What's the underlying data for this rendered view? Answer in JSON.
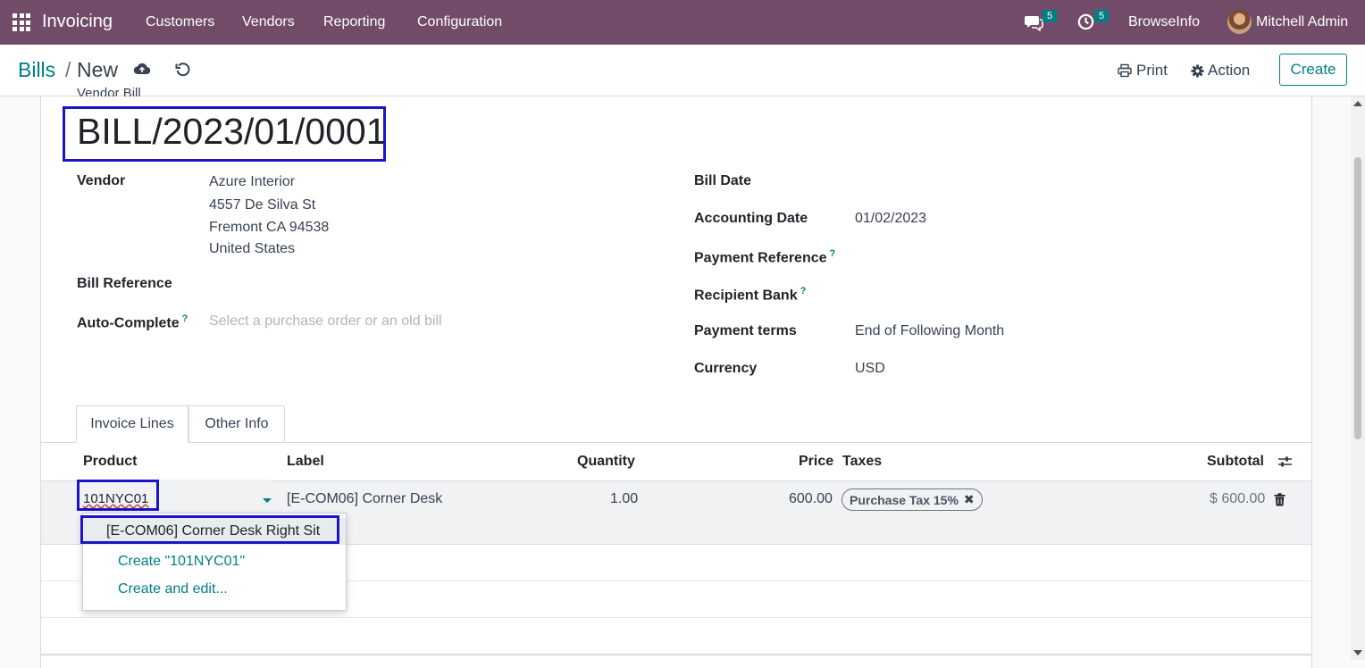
{
  "navbar": {
    "app_name": "Invoicing",
    "menu": [
      "Customers",
      "Vendors",
      "Reporting",
      "Configuration"
    ],
    "messages_count": "5",
    "activities_count": "5",
    "company": "BrowseInfo",
    "user": "Mitchell Admin"
  },
  "breadcrumb": {
    "parent": "Bills",
    "separator": "/",
    "current": "New"
  },
  "control_panel": {
    "print_label": "Print",
    "action_label": "Action",
    "create_label": "Create"
  },
  "form": {
    "doc_type_label": "Vendor Bill",
    "bill_number": "BILL/2023/01/0001",
    "vendor": {
      "label": "Vendor",
      "name": "Azure Interior",
      "street": "4557 De Silva St",
      "city": "Fremont CA 94538",
      "country": "United States"
    },
    "bill_reference_label": "Bill Reference",
    "auto_complete": {
      "label": "Auto-Complete",
      "help": "?",
      "placeholder": "Select a purchase order or an old bill"
    },
    "bill_date_label": "Bill Date",
    "accounting_date": {
      "label": "Accounting Date",
      "value": "01/02/2023"
    },
    "payment_reference": {
      "label": "Payment Reference",
      "help": "?"
    },
    "recipient_bank": {
      "label": "Recipient Bank",
      "help": "?"
    },
    "payment_terms": {
      "label": "Payment terms",
      "value": "End of Following Month"
    },
    "currency": {
      "label": "Currency",
      "value": "USD"
    }
  },
  "tabs": [
    "Invoice Lines",
    "Other Info"
  ],
  "lines_table": {
    "headers": {
      "product": "Product",
      "label": "Label",
      "quantity": "Quantity",
      "price": "Price",
      "taxes": "Taxes",
      "subtotal": "Subtotal"
    },
    "row": {
      "product_input": "101NYC01",
      "label": "[E-COM06] Corner Desk",
      "quantity": "1.00",
      "price": "600.00",
      "tax": "Purchase Tax 15%",
      "subtotal": "$ 600.00"
    }
  },
  "autocomplete_dropdown": {
    "suggestion": "[E-COM06] Corner Desk Right Sit",
    "create": "Create \"101NYC01\"",
    "create_and_edit": "Create and edit..."
  },
  "colors": {
    "navbar": "#714b67",
    "accent": "#017e84",
    "highlight_box": "#1b14c9"
  }
}
